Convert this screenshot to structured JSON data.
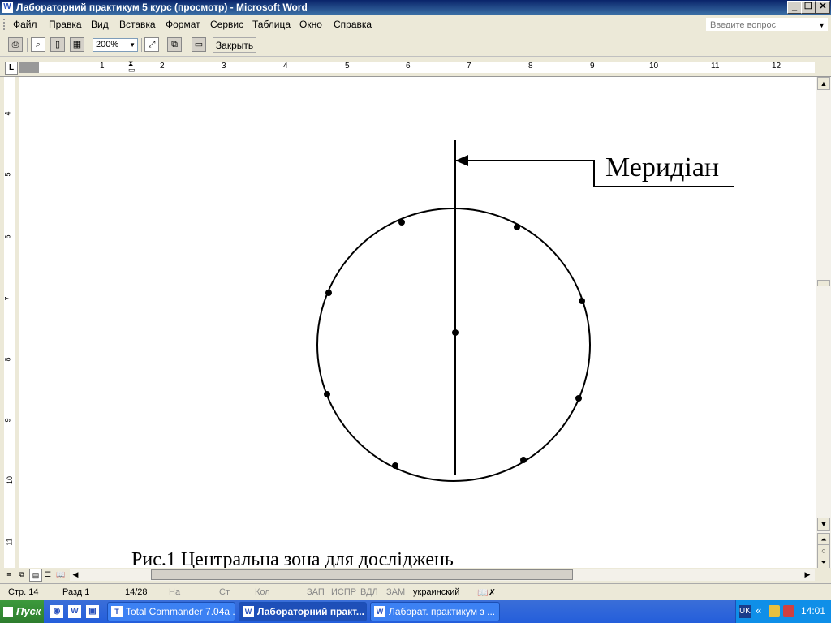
{
  "window": {
    "title": "Лабораторний практикум 5 курс (просмотр) - Microsoft Word",
    "app_icon": "word-icon"
  },
  "menubar": {
    "items": [
      "Файл",
      "Правка",
      "Вид",
      "Вставка",
      "Формат",
      "Сервис",
      "Таблица",
      "Окно",
      "Справка"
    ],
    "ask_placeholder": "Введите вопрос"
  },
  "toolbar": {
    "zoom": "200%",
    "close_label": "Закрыть"
  },
  "ruler": {
    "h_numbers": [
      "1",
      "2",
      "3",
      "4",
      "5",
      "6",
      "7",
      "8",
      "9",
      "10",
      "11",
      "12"
    ],
    "v_numbers": [
      "4",
      "5",
      "6",
      "7",
      "8",
      "9",
      "10",
      "11"
    ]
  },
  "document": {
    "meridian_label": "Меридіан",
    "caption": "Рис.1 Центральна зона для досліджень",
    "figure": {
      "shape": "circle",
      "point_count": 9,
      "line": "vertical-meridian-with-arrow"
    }
  },
  "statusbar": {
    "page": "Стр.  14",
    "section": "Разд  1",
    "pages": "14/28",
    "at": "На",
    "line": "Ст",
    "col": "Кол",
    "rec": "ЗАП",
    "trk": "ИСПР",
    "ext": "ВДЛ",
    "ovr": "ЗАМ",
    "language": "украинский"
  },
  "taskbar": {
    "start_label": "Пуск",
    "tasks": [
      {
        "label": "Total Commander 7.04a ..."
      },
      {
        "label": "Лабораторний практ..."
      },
      {
        "label": "Лаборат. практикум з ..."
      }
    ],
    "tray": {
      "lang": "UK",
      "time": "14:01"
    }
  }
}
